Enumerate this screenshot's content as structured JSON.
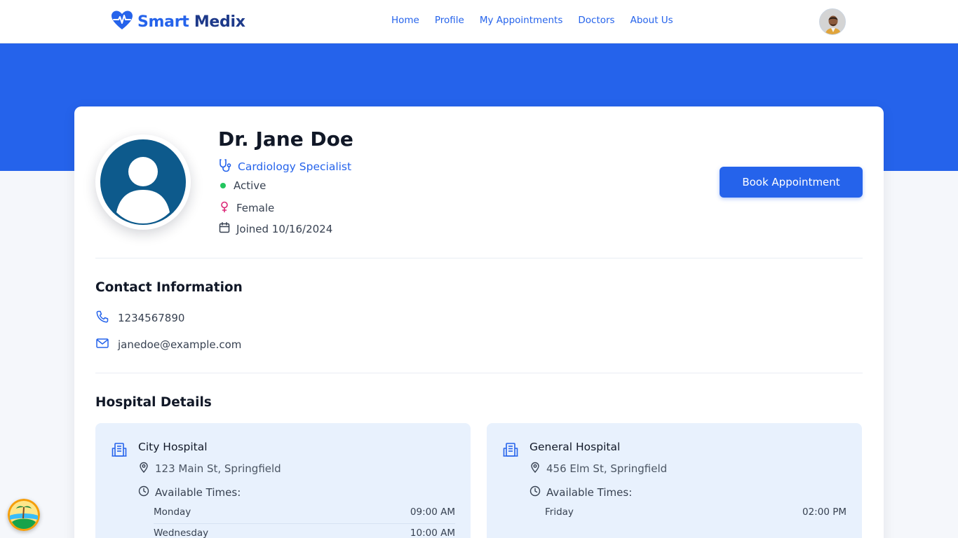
{
  "brand": {
    "part1": "Smart",
    "part2": "Medix",
    "logo_icon": "heart-pulse-icon",
    "color": "#2563eb"
  },
  "nav": {
    "links": [
      {
        "label": "Home"
      },
      {
        "label": "Profile"
      },
      {
        "label": "My Appointments"
      },
      {
        "label": "Doctors"
      },
      {
        "label": "About Us"
      }
    ]
  },
  "doctor": {
    "name": "Dr. Jane Doe",
    "specialty": "Cardiology Specialist",
    "status": "Active",
    "gender": "Female",
    "joined": "Joined 10/16/2024"
  },
  "actions": {
    "book_label": "Book Appointment"
  },
  "contact": {
    "title": "Contact Information",
    "phone": "1234567890",
    "email": "janedoe@example.com"
  },
  "hospitals": {
    "title": "Hospital Details",
    "times_label": "Available Times:",
    "items": [
      {
        "name": "City Hospital",
        "address": "123 Main St, Springfield",
        "times": [
          {
            "day": "Monday",
            "time": "09:00 AM"
          },
          {
            "day": "Wednesday",
            "time": "10:00 AM"
          }
        ]
      },
      {
        "name": "General Hospital",
        "address": "456 Elm St, Springfield",
        "times": [
          {
            "day": "Friday",
            "time": "02:00 PM"
          }
        ]
      }
    ]
  },
  "colors": {
    "primary": "#2563eb",
    "status_active": "#22c55e",
    "hospital_bg": "#e8f1fd"
  }
}
